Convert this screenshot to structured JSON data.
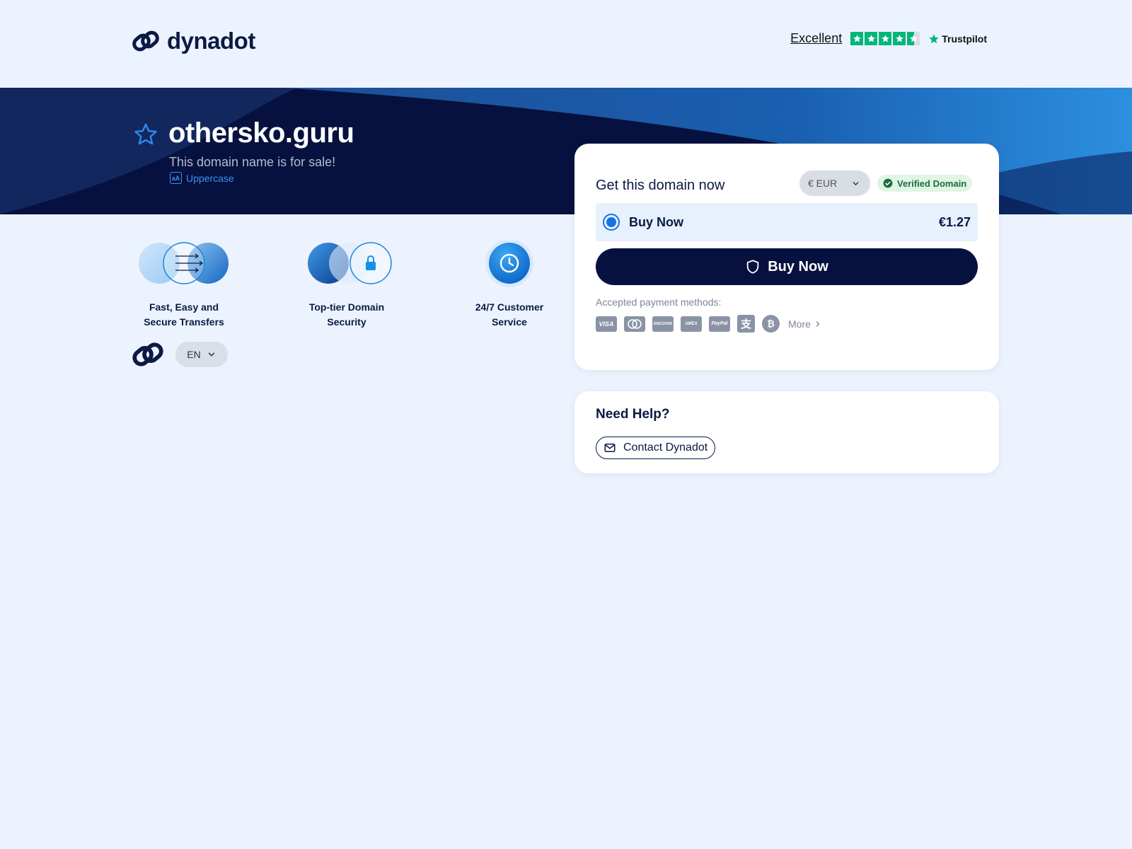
{
  "brand": {
    "name": "dynadot"
  },
  "trustpilot": {
    "rating_label": "Excellent",
    "provider": "Trustpilot",
    "stars_filled": 4.5,
    "stars_total": 5,
    "color": "#00b67a"
  },
  "hero": {
    "domain": "othersko.guru",
    "subtitle": "This domain name is for sale!",
    "case_toggle_icon_text": "aA",
    "case_toggle_label": "Uppercase"
  },
  "features": [
    {
      "label_line1": "Fast, Easy and",
      "label_line2": "Secure Transfers",
      "icon": "transfer-icon"
    },
    {
      "label_line1": "Top-tier Domain",
      "label_line2": "Security",
      "icon": "lock-icon"
    },
    {
      "label_line1": "24/7 Customer",
      "label_line2": "Service",
      "icon": "clock-icon"
    }
  ],
  "language": {
    "selected": "EN"
  },
  "purchase": {
    "title": "Get this domain now",
    "currency": "€ EUR",
    "verified_label": "Verified Domain",
    "option_label": "Buy Now",
    "option_price": "€1.27",
    "button_label": "Buy Now",
    "payment_label": "Accepted payment methods:",
    "payment_methods": [
      "VISA",
      "mastercard",
      "DISCOVER",
      "AMEX",
      "PayPal",
      "Alipay",
      "Bitcoin"
    ],
    "more_label": "More"
  },
  "help": {
    "title": "Need Help?",
    "contact_label": "Contact Dynadot"
  },
  "colors": {
    "navy": "#06113f",
    "accent": "#1372e6",
    "background": "#ecf3fe",
    "verified_green": "#1f6a3d"
  }
}
